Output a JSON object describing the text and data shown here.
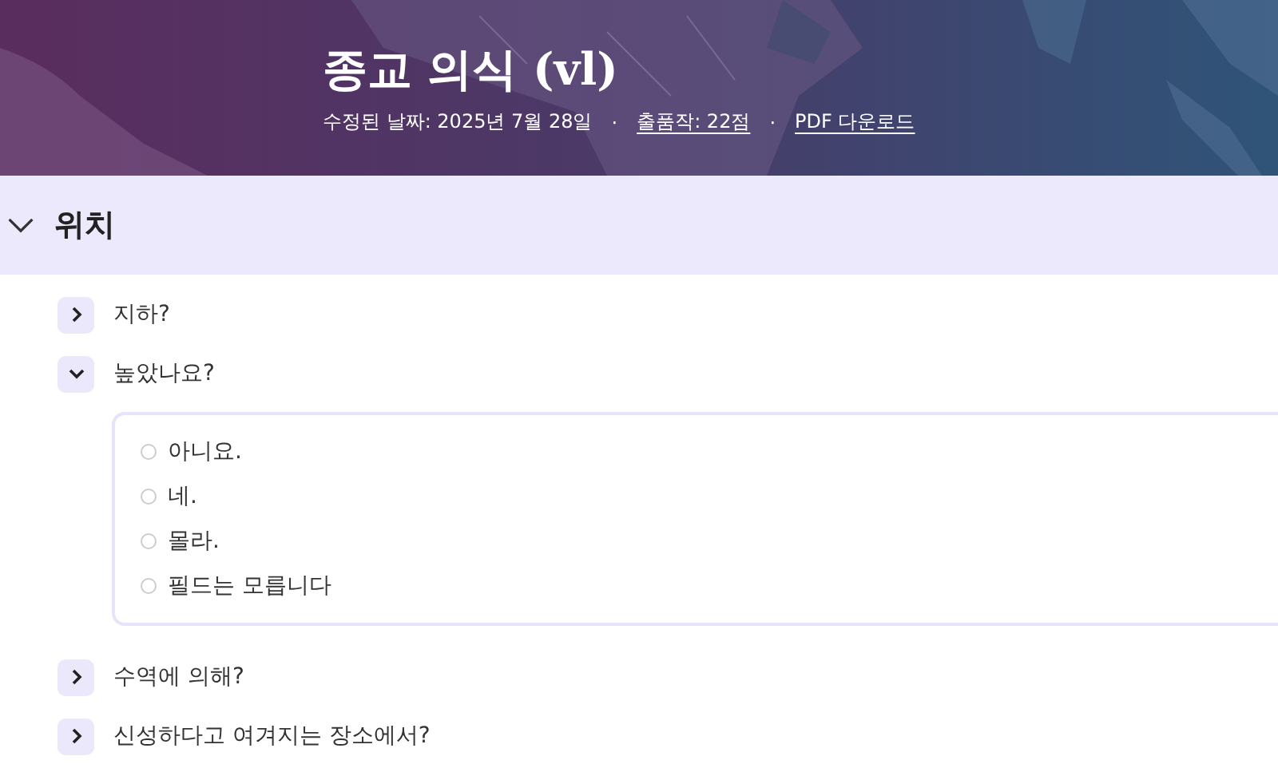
{
  "header": {
    "title": "종교 의식 (vl)",
    "meta": [
      {
        "text": "수정된 날짜: 2025년 7월 28일",
        "kind": "text"
      },
      {
        "text": "·",
        "kind": "separator"
      },
      {
        "text": "출품작: 22점",
        "kind": "link"
      },
      {
        "text": "·",
        "kind": "separator"
      },
      {
        "text": "PDF 다운로드",
        "kind": "link"
      }
    ]
  },
  "section": {
    "title": "위치",
    "expanded": true,
    "questions": [
      {
        "text": "지하?",
        "expanded": false
      },
      {
        "text": "높았나요?",
        "expanded": true,
        "options": [
          {
            "label": "아니요.",
            "selected": false
          },
          {
            "label": "네.",
            "selected": false
          },
          {
            "label": "몰라.",
            "selected": false
          },
          {
            "label": "필드는 모릅니다",
            "selected": false
          }
        ]
      },
      {
        "text": "수역에 의해?",
        "expanded": false
      },
      {
        "text": "신성하다고 여겨지는 장소에서?",
        "expanded": false
      }
    ]
  }
}
